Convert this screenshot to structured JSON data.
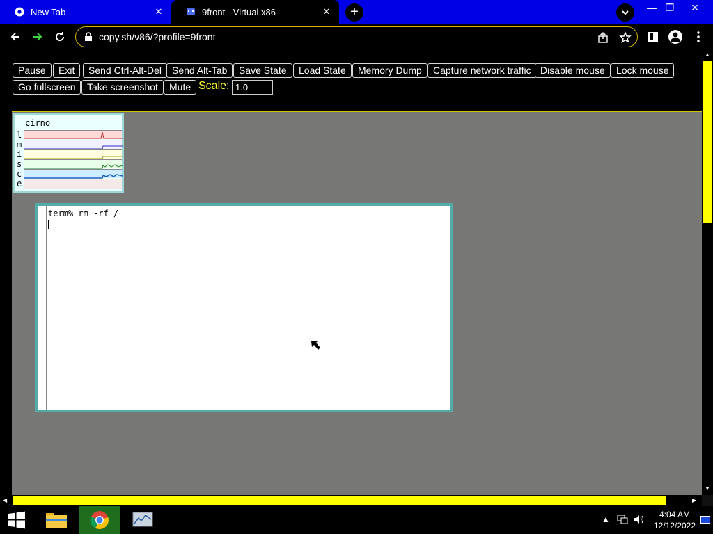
{
  "browser": {
    "tabs": [
      {
        "title": "New Tab",
        "active": false
      },
      {
        "title": "9front - Virtual x86",
        "active": true
      }
    ],
    "url": "copy.sh/v86/?profile=9front",
    "accent_color": "#0000e6"
  },
  "controls": {
    "buttons": [
      "Pause",
      "Exit",
      "Send Ctrl-Alt-Del",
      "Send Alt-Tab",
      "Save State",
      "Load State",
      "Memory Dump",
      "Capture network traffic",
      "Disable mouse",
      "Lock mouse",
      "Go fullscreen",
      "Take screenshot",
      "Mute"
    ],
    "scale_label": "Scale:",
    "scale_value": "1.0"
  },
  "emulator": {
    "stats_window": {
      "title": "cirno",
      "rows": [
        "l",
        "m",
        "i",
        "s",
        "c",
        "e"
      ],
      "row_colors": [
        "#ffd8d8",
        "#f0f0ff",
        "#ffffe0",
        "#e8ffe8",
        "#ccecff",
        "#f4e8e8"
      ]
    },
    "terminal": {
      "line1": "term% rm -rf /"
    }
  },
  "taskbar": {
    "time": "4:04 AM",
    "date": "12/12/2022",
    "apps": [
      "file-explorer",
      "chrome",
      "performance-monitor"
    ]
  }
}
